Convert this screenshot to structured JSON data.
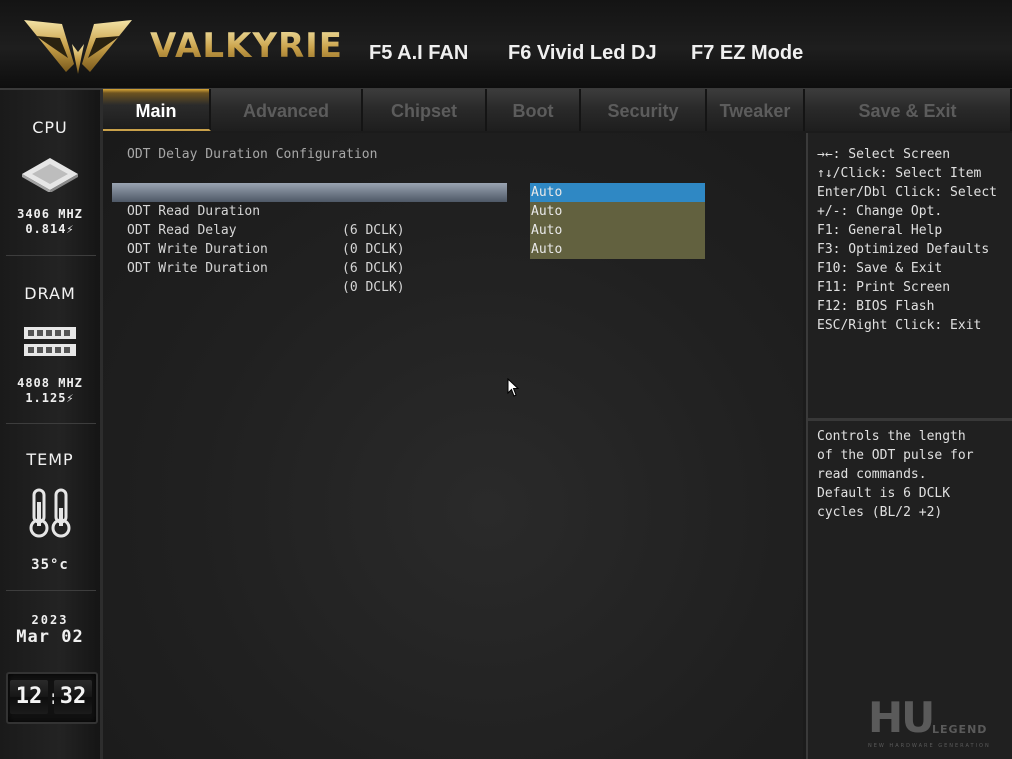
{
  "header": {
    "brand": "VALKYRIE",
    "hotkeys": [
      "F5 A.I FAN",
      "F6 Vivid Led DJ",
      "F7 EZ Mode"
    ]
  },
  "sidebar": {
    "cpu": {
      "title": "CPU",
      "freq": "3406 MHZ",
      "volt": "0.814⚡"
    },
    "dram": {
      "title": "DRAM",
      "freq": "4808 MHZ",
      "volt": "1.125⚡"
    },
    "temp": {
      "title": "TEMP",
      "value": "35°c"
    },
    "date": {
      "year": "2023",
      "day": "Mar 02"
    },
    "clock": {
      "hour": "12",
      "minute": "32"
    }
  },
  "tabs": [
    "Main",
    "Advanced",
    "Chipset",
    "Boot",
    "Security",
    "Tweaker",
    "Save & Exit"
  ],
  "active_tab": "Main",
  "main": {
    "section_title": "ODT Delay Duration Configuration",
    "rows": [
      {
        "label": "ODT Read Duration",
        "value": "(6 DCLK)",
        "option": "Auto",
        "selected": true
      },
      {
        "label": "ODT Read Delay",
        "value": "(0 DCLK)",
        "option": "Auto",
        "selected": false
      },
      {
        "label": "ODT Write Duration",
        "value": "(6 DCLK)",
        "option": "Auto",
        "selected": false
      },
      {
        "label": "ODT Write Duration",
        "value": "(0 DCLK)",
        "option": "Auto",
        "selected": false
      }
    ]
  },
  "help": [
    "→←: Select Screen",
    "↑↓/Click: Select Item",
    "Enter/Dbl Click: Select",
    "+/-: Change Opt.",
    "F1: General Help",
    "F3: Optimized Defaults",
    "F10: Save & Exit",
    "F11: Print Screen",
    "F12: BIOS Flash",
    "ESC/Right Click: Exit"
  ],
  "description": [
    "Controls the length",
    "of the ODT pulse for",
    "read commands.",
    "Default is 6 DCLK",
    "cycles (BL/2 +2)"
  ],
  "watermark": {
    "big": "HU",
    "small": "LEGEND",
    "tiny": "NEW HARDWARE GENERATION"
  },
  "colors": {
    "accent_gold": "#c9a14a",
    "selected_option": "#2f88c4",
    "option_bg": "#62613f"
  }
}
